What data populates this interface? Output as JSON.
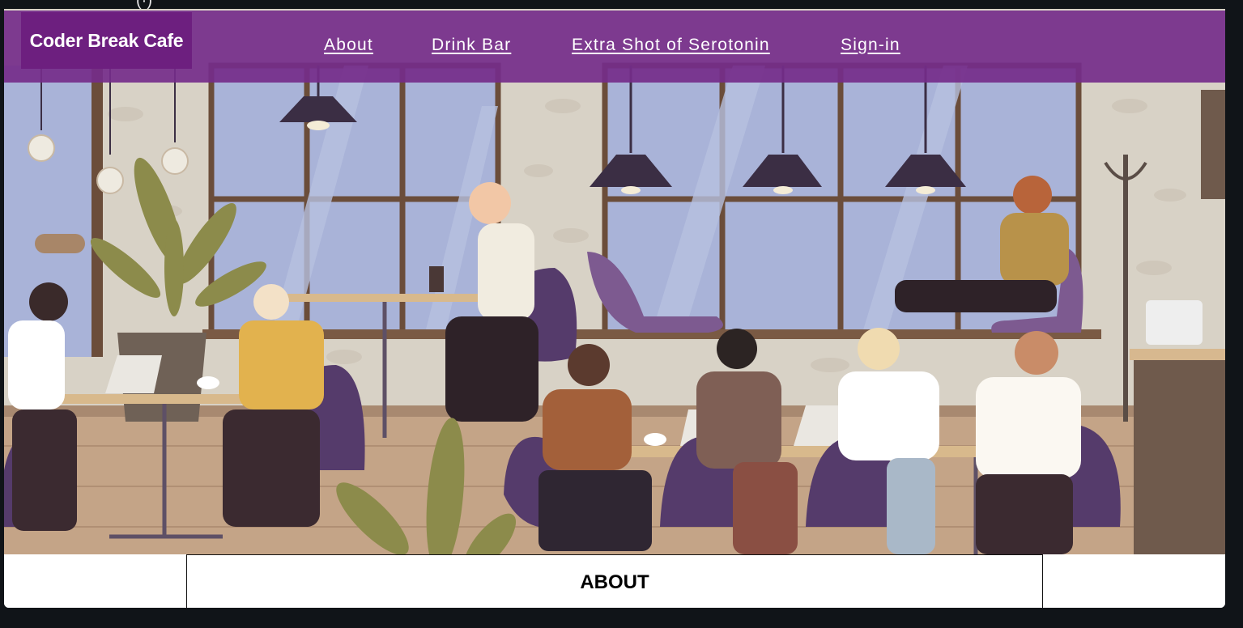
{
  "top_strip_glyph": "(·)",
  "brand": {
    "name": "Coder Break Cafe"
  },
  "nav": {
    "items": [
      {
        "label": "About"
      },
      {
        "label": "Drink Bar"
      },
      {
        "label": "Extra Shot of Serotonin"
      },
      {
        "label": "Sign-in"
      }
    ]
  },
  "hero": {
    "illustration": "cafe-scene-illustration"
  },
  "about": {
    "heading": "ABOUT"
  },
  "colors": {
    "navbar": "#752c8a",
    "brand_bg": "#6d1f7f",
    "page_bg": "#101418",
    "window_glass": "#a9b3d8",
    "chair_purple": "#553b6b"
  }
}
